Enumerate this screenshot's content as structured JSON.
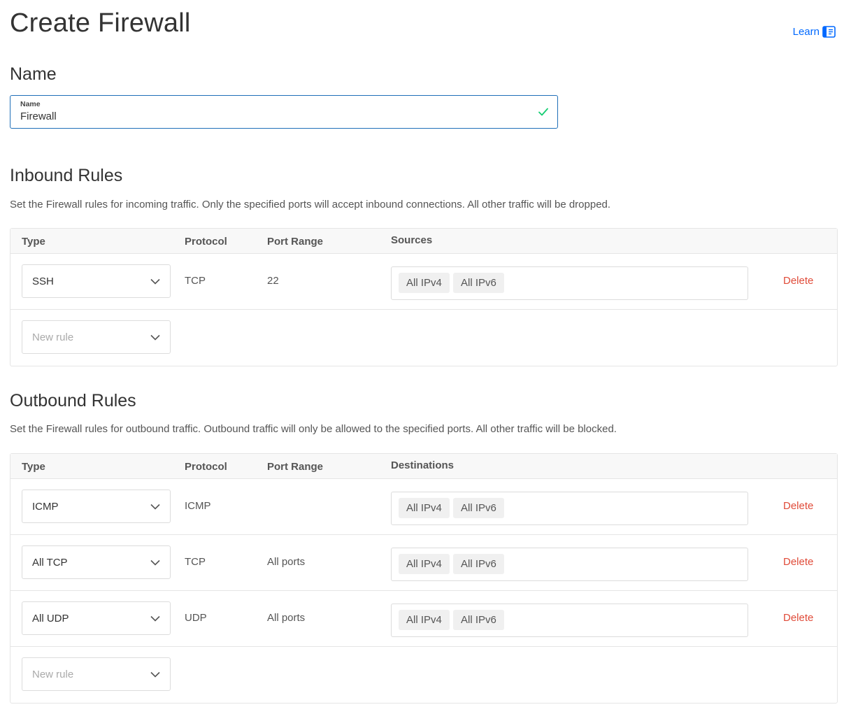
{
  "page": {
    "title": "Create Firewall",
    "learn_label": "Learn"
  },
  "name_section": {
    "heading": "Name",
    "field_label": "Name",
    "field_value": "Firewall"
  },
  "inbound": {
    "heading": "Inbound Rules",
    "description": "Set the Firewall rules for incoming traffic. Only the specified ports will accept inbound connections. All other traffic will be dropped.",
    "columns": {
      "type": "Type",
      "protocol": "Protocol",
      "port_range": "Port Range",
      "targets": "Sources"
    },
    "rules": [
      {
        "type": "SSH",
        "protocol": "TCP",
        "port_range": "22",
        "targets": [
          "All IPv4",
          "All IPv6"
        ],
        "delete_label": "Delete"
      }
    ],
    "new_rule_placeholder": "New rule"
  },
  "outbound": {
    "heading": "Outbound Rules",
    "description": "Set the Firewall rules for outbound traffic. Outbound traffic will only be allowed to the specified ports. All other traffic will be blocked.",
    "columns": {
      "type": "Type",
      "protocol": "Protocol",
      "port_range": "Port Range",
      "targets": "Destinations"
    },
    "rules": [
      {
        "type": "ICMP",
        "protocol": "ICMP",
        "port_range": "",
        "targets": [
          "All IPv4",
          "All IPv6"
        ],
        "delete_label": "Delete"
      },
      {
        "type": "All TCP",
        "protocol": "TCP",
        "port_range": "All ports",
        "targets": [
          "All IPv4",
          "All IPv6"
        ],
        "delete_label": "Delete"
      },
      {
        "type": "All UDP",
        "protocol": "UDP",
        "port_range": "All ports",
        "targets": [
          "All IPv4",
          "All IPv6"
        ],
        "delete_label": "Delete"
      }
    ],
    "new_rule_placeholder": "New rule"
  },
  "icons": {
    "learn": "book-icon",
    "field_valid": "checkmark-icon",
    "select": "chevron-down-icon"
  },
  "colors": {
    "link": "#0069ff",
    "delete": "#e04b39",
    "valid_check": "#15cd72",
    "input_focus_border": "#1f6fb8"
  }
}
